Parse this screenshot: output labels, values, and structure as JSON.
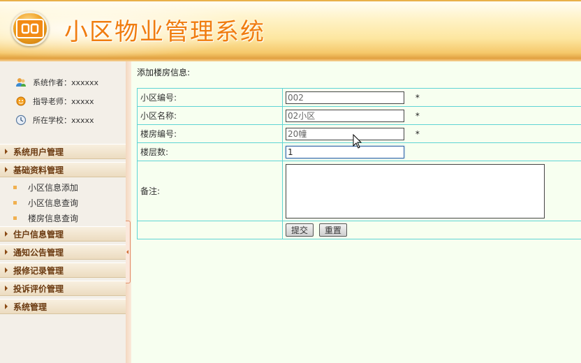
{
  "app": {
    "title": "小区物业管理系统",
    "logo_text": "OO",
    "accent_color": "#f07d10"
  },
  "sidebar": {
    "info": [
      {
        "icon": "users-icon",
        "label": "系统作者：xxxxxx"
      },
      {
        "icon": "teacher-icon",
        "label": "指导老师：xxxxx"
      },
      {
        "icon": "clock-icon",
        "label": "所在学校：xxxxx"
      }
    ],
    "menu": [
      {
        "label": "系统用户管理"
      },
      {
        "label": "基础资料管理",
        "children": [
          {
            "label": "小区信息添加"
          },
          {
            "label": "小区信息查询"
          },
          {
            "label": "楼房信息查询"
          }
        ]
      },
      {
        "label": "住户信息管理"
      },
      {
        "label": "通知公告管理"
      },
      {
        "label": "报修记录管理"
      },
      {
        "label": "投诉评价管理"
      },
      {
        "label": "系统管理"
      }
    ]
  },
  "main": {
    "title": "添加楼房信息:",
    "form": {
      "rows": [
        {
          "label": "小区编号:",
          "value": "002",
          "required": "*"
        },
        {
          "label": "小区名称:",
          "value": "02小区",
          "required": "*"
        },
        {
          "label": "楼房编号:",
          "value": "20幢",
          "required": "*"
        },
        {
          "label": "楼层数:",
          "value": "1"
        },
        {
          "label": "备注:",
          "value": ""
        }
      ],
      "submit_label": "提交",
      "reset_label": "重置"
    }
  }
}
